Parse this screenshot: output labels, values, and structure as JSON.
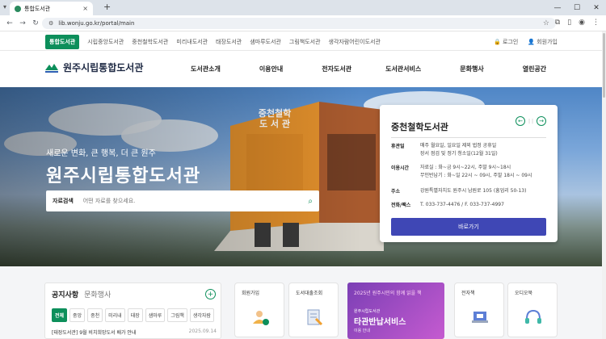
{
  "browser": {
    "tab_title": "통합도서관",
    "url": "lib.wonju.go.kr/portal/main"
  },
  "topnav": {
    "items": [
      "통합도서관",
      "시립중앙도서관",
      "중천철학도서관",
      "미리내도서관",
      "태장도서관",
      "샘마루도서관",
      "그림책도서관",
      "생각자람어린이도서관"
    ],
    "login": "로그인",
    "signup": "회원가입"
  },
  "header": {
    "logo": "원주시립통합도서관",
    "menu": [
      "도서관소개",
      "이용안내",
      "전자도서관",
      "도서관서비스",
      "문화행사",
      "열린공간"
    ]
  },
  "hero": {
    "slogan": "새로운 변화, 큰 행복, 더 큰 원주",
    "title": "원주시립통합도서관",
    "building_sign": "중천철학 도서관",
    "search_label": "자료검색",
    "search_placeholder": "어떤 자료를 찾으세요."
  },
  "card": {
    "title": "중천철학도서관",
    "rows": [
      {
        "k": "휴관일",
        "v1": "매주 월요일, 일요일 제외 법정 공휴일",
        "v2": "장서 점검 및 정기 청소일(12월 31일)"
      },
      {
        "k": "이용시간",
        "v1": "자료실 : 화~금 9시~22시, 주말 9시~18시",
        "v2": "무인반납기 : 화~일 22시 ~ 09시, 주말 18시 ~ 09시"
      },
      {
        "k": "주소",
        "v1": "강원특별자치도 원주시 남원로 105 (흥업리 50-13)",
        "v2": ""
      },
      {
        "k": "전화/팩스",
        "v1": "T. 033-737-4476 / F. 033-737-4997",
        "v2": ""
      }
    ],
    "button": "바로가기"
  },
  "notice": {
    "tab_active": "공지사항",
    "tab_other": "문화행사",
    "categories": [
      "전체",
      "중앙",
      "중천",
      "미리내",
      "태장",
      "샘마루",
      "그림책",
      "생각자람"
    ],
    "first_item": "[태장도서관] 9월 비치희망도서 배가 안내",
    "first_date": "2025.09.14"
  },
  "quick": {
    "q1": "회원가입",
    "q2": "도서대출조회",
    "q3": "전자책",
    "q4": "오디오북"
  },
  "banner": {
    "top": "2025년 원주시민의 함께 읽을 책",
    "small": "원주시립도서관",
    "main": "타관반납서비스",
    "foot": "이용 안내"
  }
}
